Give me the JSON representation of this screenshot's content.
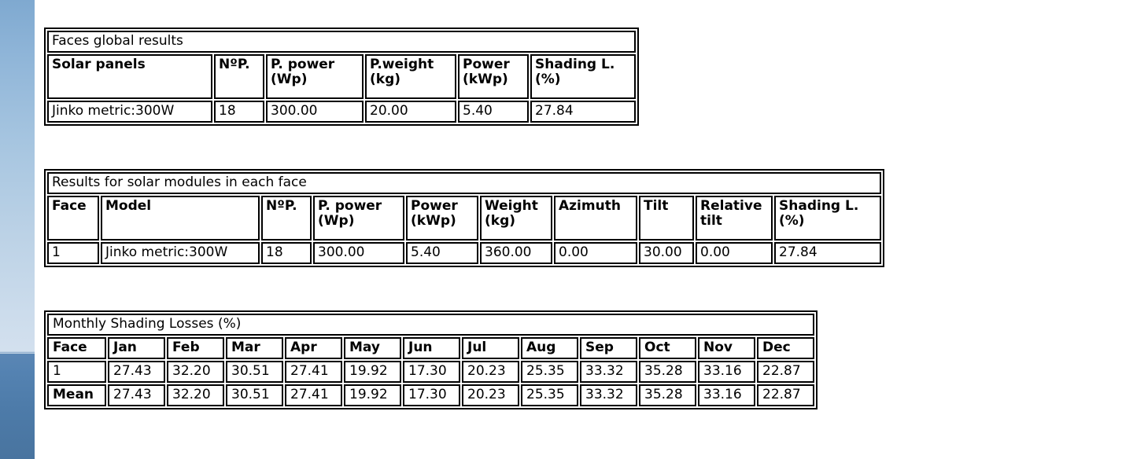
{
  "tables": {
    "faces_global": {
      "caption": "Faces global results",
      "headers": [
        "Solar panels",
        "NºP.",
        "P. power\n(Wp)",
        "P.weight\n(kg)",
        "Power\n(kWp)",
        "Shading L.\n(%)"
      ],
      "rows": [
        [
          "Jinko metric:300W",
          "18",
          "300.00",
          "20.00",
          "5.40",
          "27.84"
        ]
      ]
    },
    "face_modules": {
      "caption": "Results for solar modules in each face",
      "headers": [
        "Face",
        "Model",
        "NºP.",
        "P. power\n(Wp)",
        "Power\n(kWp)",
        "Weight\n(kg)",
        "Azimuth",
        "Tilt",
        "Relative\ntilt",
        "Shading L.\n(%)"
      ],
      "rows": [
        [
          "1",
          "Jinko metric:300W",
          "18",
          "300.00",
          "5.40",
          "360.00",
          "0.00",
          "30.00",
          "0.00",
          "27.84"
        ]
      ]
    },
    "monthly_shading": {
      "caption": "Monthly Shading Losses (%)",
      "headers": [
        "Face",
        "Jan",
        "Feb",
        "Mar",
        "Apr",
        "May",
        "Jun",
        "Jul",
        "Aug",
        "Sep",
        "Oct",
        "Nov",
        "Dec"
      ],
      "rows": [
        [
          "1",
          "27.43",
          "32.20",
          "30.51",
          "27.41",
          "19.92",
          "17.30",
          "20.23",
          "25.35",
          "33.32",
          "35.28",
          "33.16",
          "22.87"
        ],
        [
          "Mean",
          "27.43",
          "32.20",
          "30.51",
          "27.41",
          "19.92",
          "17.30",
          "20.23",
          "25.35",
          "33.32",
          "35.28",
          "33.16",
          "22.87"
        ]
      ]
    }
  },
  "colors": {
    "border": "#000000",
    "text": "#000000",
    "page_background": "#ffffff",
    "wallpaper_sky": "#8fb5d8",
    "wallpaper_sea": "#5583b2"
  }
}
